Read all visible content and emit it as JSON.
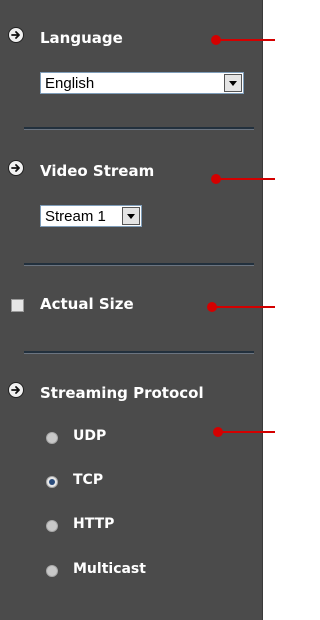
{
  "sections": {
    "language": {
      "title": "Language",
      "selected": "English"
    },
    "video_stream": {
      "title": "Video Stream",
      "selected": "Stream 1"
    },
    "actual_size": {
      "title": "Actual Size",
      "checked": false
    },
    "streaming_protocol": {
      "title": "Streaming Protocol",
      "options": [
        {
          "label": "UDP",
          "selected": false
        },
        {
          "label": "TCP",
          "selected": true
        },
        {
          "label": "HTTP",
          "selected": false
        },
        {
          "label": "Multicast",
          "selected": false
        }
      ]
    }
  },
  "colors": {
    "panel_bg": "#4b4b4b",
    "label_text": "#ffffff",
    "pointer_red": "#d40000",
    "divider": "#22303d"
  }
}
